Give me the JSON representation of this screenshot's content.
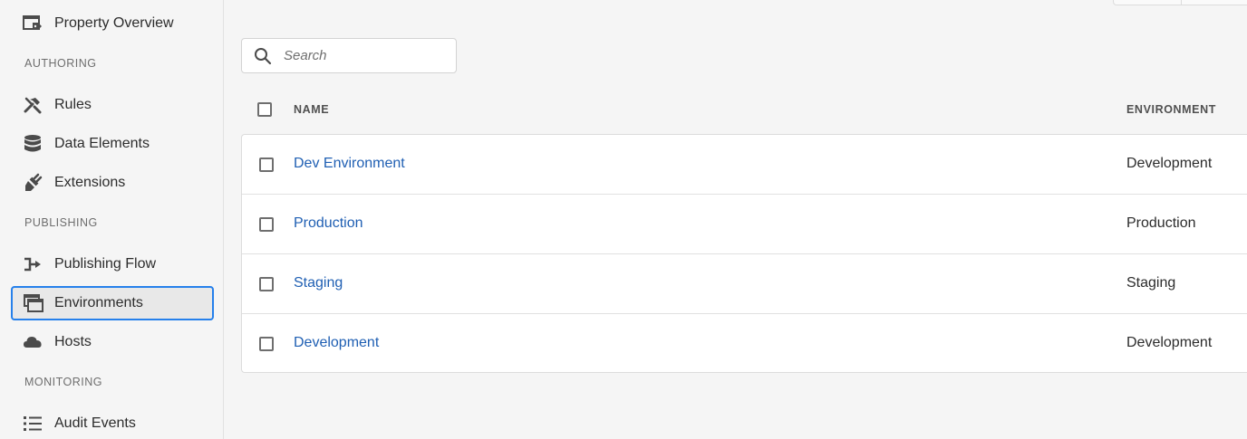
{
  "sidebar": {
    "items": [
      {
        "label": "Property Overview",
        "icon": "property-overview-icon"
      },
      {
        "label": "Rules",
        "icon": "hammer-icon"
      },
      {
        "label": "Data Elements",
        "icon": "database-icon"
      },
      {
        "label": "Extensions",
        "icon": "plug-icon"
      },
      {
        "label": "Publishing Flow",
        "icon": "publishing-flow-icon"
      },
      {
        "label": "Environments",
        "icon": "windows-icon",
        "selected": true
      },
      {
        "label": "Hosts",
        "icon": "cloud-icon"
      },
      {
        "label": "Audit Events",
        "icon": "list-icon"
      }
    ],
    "sections": {
      "authoring": "AUTHORING",
      "publishing": "PUBLISHING",
      "monitoring": "MONITORING"
    }
  },
  "search": {
    "placeholder": "Search",
    "value": ""
  },
  "table": {
    "columns": {
      "name": "NAME",
      "environment": "ENVIRONMENT"
    },
    "rows": [
      {
        "name": "Dev Environment",
        "environment": "Development"
      },
      {
        "name": "Production",
        "environment": "Production"
      },
      {
        "name": "Staging",
        "environment": "Staging"
      },
      {
        "name": "Development",
        "environment": "Development"
      }
    ]
  },
  "colors": {
    "accent": "#2680eb",
    "link": "#1f5fb3",
    "selected_bg": "#e8e8e8"
  }
}
